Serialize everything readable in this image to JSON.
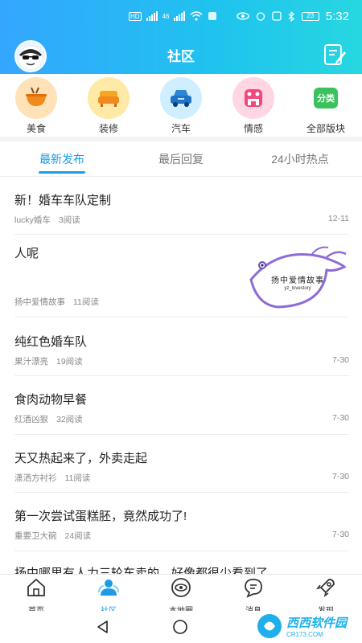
{
  "statusbar": {
    "net1": "HD",
    "net2": "46",
    "time": "5:32",
    "battery": "23"
  },
  "header": {
    "title": "社区"
  },
  "categories": [
    {
      "label": "美食",
      "color": "#ffe2b8"
    },
    {
      "label": "装修",
      "color": "#ffe9a6"
    },
    {
      "label": "汽车",
      "color": "#cfeeff"
    },
    {
      "label": "情感",
      "color": "#ffd6e2"
    },
    {
      "label": "全部版块",
      "icon_text": "分类",
      "color": "#ffffff"
    }
  ],
  "tabs": [
    {
      "label": "最新发布",
      "active": true
    },
    {
      "label": "最后回复",
      "active": false
    },
    {
      "label": "24小时热点",
      "active": false
    }
  ],
  "posts": [
    {
      "title": "新！婚车车队定制",
      "author": "lucky婚车",
      "reads": "3阅读",
      "date": "12-11"
    },
    {
      "title": "人呢",
      "author": "扬中爱情故事",
      "reads": "11阅读",
      "date": "",
      "thumb_text": "扬中爱情故事",
      "thumb_sub": "yz_lovestory"
    },
    {
      "title": "纯红色婚车队",
      "author": "果汁漂亮",
      "reads": "19阅读",
      "date": "7-30"
    },
    {
      "title": "食肉动物早餐",
      "author": "红酒凶狠",
      "reads": "32阅读",
      "date": "7-30"
    },
    {
      "title": "天又热起来了，外卖走起",
      "author": "潇洒方衬衫",
      "reads": "11阅读",
      "date": "7-30"
    },
    {
      "title": "第一次尝试蛋糕胚，竟然成功了!",
      "author": "重要卫大碗",
      "reads": "24阅读",
      "date": "7-30"
    },
    {
      "title": "扬中哪里有人力三轮车卖的，好像都很少看到了",
      "author": "",
      "reads": "",
      "date": ""
    }
  ],
  "bottomnav": [
    {
      "label": "首页"
    },
    {
      "label": "社区"
    },
    {
      "label": "本地圈"
    },
    {
      "label": "消息"
    },
    {
      "label": "发现"
    }
  ],
  "watermark": {
    "text": "西西软件园",
    "sub": "CR173.COM"
  },
  "colors": {
    "accent": "#1e9be6",
    "header_start": "#34a6ff",
    "header_end": "#27d7e0"
  }
}
